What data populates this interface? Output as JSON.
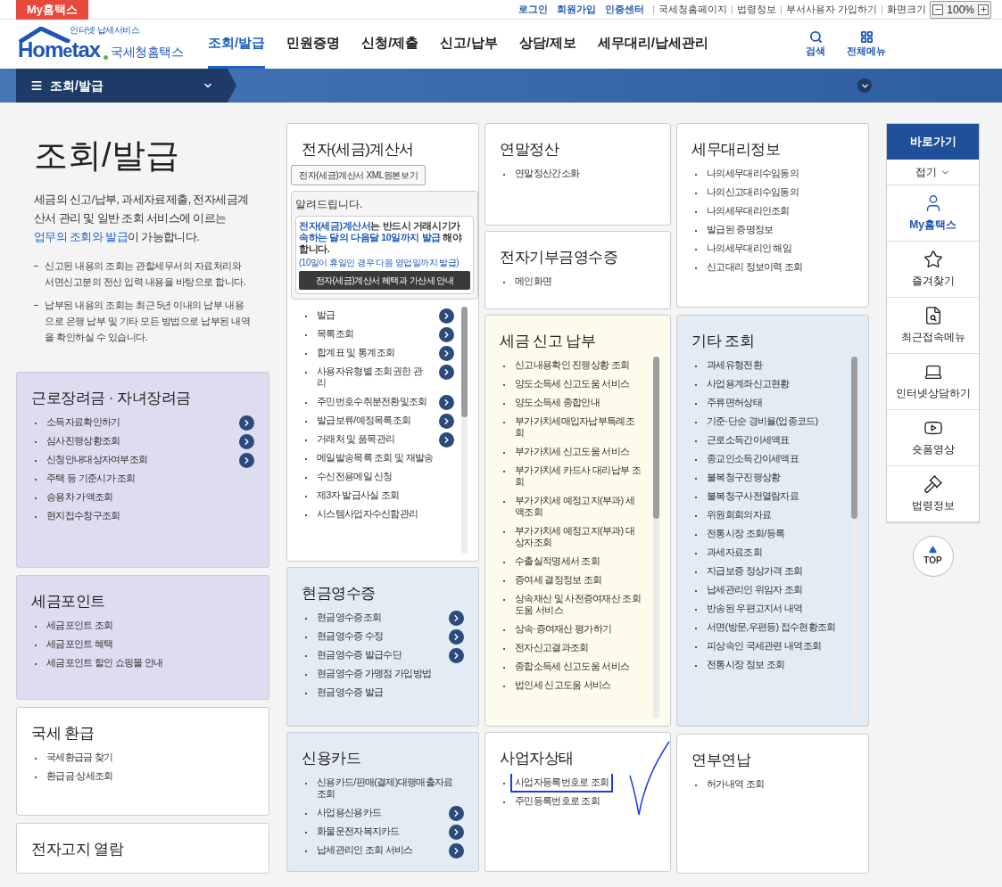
{
  "top_bar": {
    "my_tab": "My홈택스",
    "links": [
      {
        "label": "로그인",
        "emphasized": true
      },
      {
        "label": "회원가입",
        "emphasized": true
      },
      {
        "label": "인증센터",
        "emphasized": true
      },
      {
        "label": "국세청홈페이지",
        "emphasized": false
      },
      {
        "label": "법령정보",
        "emphasized": false
      },
      {
        "label": "부서사용자 가입하기",
        "emphasized": false
      }
    ],
    "zoom": {
      "label": "화면크기",
      "value": "100%"
    }
  },
  "header": {
    "logo": {
      "tagline": "인터넷 납세서비스",
      "wordmark_left": "Hom",
      "wordmark_mid": "e",
      "wordmark_right": "tax",
      "name": "국세청홈택스"
    },
    "menu": [
      {
        "label": "조회/발급",
        "selected": true
      },
      {
        "label": "민원증명",
        "selected": false
      },
      {
        "label": "신청/제출",
        "selected": false
      },
      {
        "label": "신고/납부",
        "selected": false
      },
      {
        "label": "상담/제보",
        "selected": false
      },
      {
        "label": "세무대리/납세관리",
        "selected": false
      }
    ],
    "tools": [
      {
        "kind": "search",
        "label": "검색"
      },
      {
        "kind": "grid",
        "label": "전체메뉴"
      }
    ]
  },
  "breadcrumb": {
    "label": "조회/발급"
  },
  "intro": {
    "title": "조회/발급",
    "lead": [
      {
        "text": "세금의 신고/납부, 과세자료제출, 전자세금계산서 관리 및 일반 조회 서비스에 이르는 ",
        "link": false
      },
      {
        "text": "업무의 조회와 발급",
        "link": true
      },
      {
        "text": "이 가능합니다.",
        "link": false
      }
    ],
    "notes": [
      "신고된 내용의 조회는 관할세무서의 자료처리와 서면신고분의 전산 입력 내용을 바탕으로 합니다.",
      "납부된 내용의 조회는 최근 5년 이내의 납부 내용으로 은행 납부 및 기타 모든 방법으로 납부된 내역을 확인하실 수 있습니다."
    ]
  },
  "columns": [
    {
      "cards": [
        {
          "kind": "list",
          "title": "근로장려금 · 자녀장려금",
          "color": "#dddcf1",
          "scrollable": false,
          "items": [
            {
              "label": "소득자료확인하기",
              "arrow": true,
              "highlighted": false
            },
            {
              "label": "심사진행상황조회",
              "arrow": true,
              "highlighted": false
            },
            {
              "label": "신청안내대상자여부조회",
              "arrow": true,
              "highlighted": false
            },
            {
              "label": "주택 등 기준시가 조회",
              "arrow": false,
              "highlighted": false
            },
            {
              "label": "승용차 가액조회",
              "arrow": false,
              "highlighted": false
            },
            {
              "label": "현지접수창구조회",
              "arrow": false,
              "highlighted": false
            }
          ]
        },
        {
          "kind": "list",
          "title": "세금포인트",
          "color": "#dddcf1",
          "scrollable": false,
          "items": [
            {
              "label": "세금포인트 조회",
              "arrow": false,
              "highlighted": false
            },
            {
              "label": "세금포인트 혜택",
              "arrow": false,
              "highlighted": false
            },
            {
              "label": "세금포인트 할인 쇼핑몰 안내",
              "arrow": false,
              "highlighted": false
            }
          ]
        },
        {
          "kind": "list",
          "title": "국세 환급",
          "color": "#ffffff",
          "scrollable": false,
          "items": [
            {
              "label": "국세환급금 찾기",
              "arrow": false,
              "highlighted": false
            },
            {
              "label": "환급금 상세조회",
              "arrow": false,
              "highlighted": false
            }
          ]
        },
        {
          "kind": "list",
          "title": "전자고지 열람",
          "color": "#ffffff",
          "scrollable": false
        }
      ]
    },
    {
      "cards": [
        {
          "kind": "invoice",
          "title": "전자(세금)계산서",
          "color": "#ffffff",
          "scrollable": true,
          "button": "전자(세금)계산서 XML원본보기",
          "notice": {
            "title": "알려드립니다.",
            "message": [
              {
                "text": "전자(세금)계산서",
                "highlight": true
              },
              {
                "text": "는 반드시 거래시기가 ",
                "highlight": false
              },
              {
                "text": "속하는 달의 다음달 10일까지 발급",
                "highlight": true
              },
              {
                "text": " 해야 합니다.",
                "highlight": false
              }
            ],
            "footnote": "(10일이 휴일인 경우 다음 영업일까지 발급)",
            "banner": "전자(세금)계산서 혜택과 가산세 안내"
          },
          "items": [
            {
              "label": "발급",
              "arrow": true,
              "highlighted": false
            },
            {
              "label": "목록조회",
              "arrow": true,
              "highlighted": false
            },
            {
              "label": "합계표 및 통계조회",
              "arrow": true,
              "highlighted": false
            },
            {
              "label": "사용자유형별 조회권한 관리",
              "arrow": true,
              "highlighted": false
            },
            {
              "label": "주민번호수취분전환및조회",
              "arrow": true,
              "highlighted": false
            },
            {
              "label": "발급보류/예정목록조회",
              "arrow": true,
              "highlighted": false
            },
            {
              "label": "거래처 및 품목관리",
              "arrow": true,
              "highlighted": false
            },
            {
              "label": "메일발송목록 조회 및 재발송",
              "arrow": false,
              "highlighted": false
            },
            {
              "label": "수신전용메일 신청",
              "arrow": false,
              "highlighted": false
            },
            {
              "label": "제3자 발급사실 조회",
              "arrow": false,
              "highlighted": false
            },
            {
              "label": "시스템사업자수신함관리",
              "arrow": false,
              "highlighted": false
            }
          ]
        },
        {
          "kind": "list",
          "title": "현금영수증",
          "color": "#e3ebf4",
          "scrollable": false,
          "items": [
            {
              "label": "현금영수증조회",
              "arrow": true,
              "highlighted": false
            },
            {
              "label": "현금영수증 수정",
              "arrow": true,
              "highlighted": false
            },
            {
              "label": "현금영수증 발급수단",
              "arrow": true,
              "highlighted": false
            },
            {
              "label": "현금영수증 가맹점 가입방법",
              "arrow": false,
              "highlighted": false
            },
            {
              "label": "현금영수증 발급",
              "arrow": false,
              "highlighted": false
            }
          ]
        },
        {
          "kind": "list",
          "title": "신용카드",
          "color": "#e3ebf4",
          "scrollable": false,
          "items": [
            {
              "label": "신용카드/판매(결제)대행매출자료조회",
              "arrow": false,
              "highlighted": false
            },
            {
              "label": "사업용신용카드",
              "arrow": true,
              "highlighted": false
            },
            {
              "label": "화물운전자복지카드",
              "arrow": true,
              "highlighted": false
            },
            {
              "label": "납세관리인 조회 서비스",
              "arrow": true,
              "highlighted": false
            }
          ]
        }
      ]
    },
    {
      "cards": [
        {
          "kind": "list",
          "title": "연말정산",
          "color": "#ffffff",
          "scrollable": false,
          "items": [
            {
              "label": "연말정산간소화",
              "arrow": false,
              "highlighted": false
            }
          ]
        },
        {
          "kind": "list",
          "title": "전자기부금영수증",
          "color": "#ffffff",
          "scrollable": false,
          "items": [
            {
              "label": "메인화면",
              "arrow": false,
              "highlighted": false
            }
          ]
        },
        {
          "kind": "list",
          "title": "세금 신고 납부",
          "color": "#fdfbeb",
          "scrollable": true,
          "items": [
            {
              "label": "신고내용확인 진행상황 조회",
              "arrow": false,
              "highlighted": false
            },
            {
              "label": "양도소득세 신고도움 서비스",
              "arrow": false,
              "highlighted": false
            },
            {
              "label": "양도소득세 종합안내",
              "arrow": false,
              "highlighted": false
            },
            {
              "label": "부가가치세매입자납부특례조회",
              "arrow": false,
              "highlighted": false
            },
            {
              "label": "부가가치세 신고도움 서비스",
              "arrow": false,
              "highlighted": false
            },
            {
              "label": "부가가치세 카드사 대리납부 조회",
              "arrow": false,
              "highlighted": false
            },
            {
              "label": "부가가치세 예정고지(부과) 세액조회",
              "arrow": false,
              "highlighted": false
            },
            {
              "label": "부가가치세 예정고지(부과) 대상자조회",
              "arrow": false,
              "highlighted": false
            },
            {
              "label": "수출실적명세서 조회",
              "arrow": false,
              "highlighted": false
            },
            {
              "label": "증여세 결정정보 조회",
              "arrow": false,
              "highlighted": false
            },
            {
              "label": "상속재산 및 사전증여재산 조회 도움 서비스",
              "arrow": false,
              "highlighted": false
            },
            {
              "label": "상속·증여재산 평가하기",
              "arrow": false,
              "highlighted": false
            },
            {
              "label": "전자신고결과조회",
              "arrow": false,
              "highlighted": false
            },
            {
              "label": "종합소득세 신고도움 서비스",
              "arrow": false,
              "highlighted": false
            },
            {
              "label": "법인세 신고도움 서비스",
              "arrow": false,
              "highlighted": false
            }
          ]
        },
        {
          "kind": "list",
          "title": "사업자상태",
          "color": "#ffffff",
          "scrollable": false,
          "items": [
            {
              "label": "사업자등록번호로 조회",
              "arrow": false,
              "highlighted": true
            },
            {
              "label": "주민등록번호로 조회",
              "arrow": false,
              "highlighted": false
            }
          ]
        }
      ]
    },
    {
      "cards": [
        {
          "kind": "list",
          "title": "세무대리정보",
          "color": "#ffffff",
          "scrollable": false,
          "items": [
            {
              "label": "나의세무대리수임동의",
              "arrow": false,
              "highlighted": false
            },
            {
              "label": "나의신고대리수임동의",
              "arrow": false,
              "highlighted": false
            },
            {
              "label": "나의세무대리인조회",
              "arrow": false,
              "highlighted": false
            },
            {
              "label": "발급된 증명정보",
              "arrow": false,
              "highlighted": false
            },
            {
              "label": "나의세무대리인 해임",
              "arrow": false,
              "highlighted": false
            },
            {
              "label": "신고대리 정보이력 조회",
              "arrow": false,
              "highlighted": false
            }
          ]
        },
        {
          "kind": "list",
          "title": "기타 조회",
          "color": "#e3ebf4",
          "scrollable": true,
          "items": [
            {
              "label": "과세유형전환",
              "arrow": false,
              "highlighted": false
            },
            {
              "label": "사업용계좌신고현황",
              "arrow": false,
              "highlighted": false
            },
            {
              "label": "주류면허상태",
              "arrow": false,
              "highlighted": false
            },
            {
              "label": "기준·단순 경비율(업종코드)",
              "arrow": false,
              "highlighted": false
            },
            {
              "label": "근로소득간이세액표",
              "arrow": false,
              "highlighted": false
            },
            {
              "label": "종교인소득간이세액표",
              "arrow": false,
              "highlighted": false
            },
            {
              "label": "불복청구진행상황",
              "arrow": false,
              "highlighted": false
            },
            {
              "label": "불복청구사전열람자료",
              "arrow": false,
              "highlighted": false
            },
            {
              "label": "위원회회의자료",
              "arrow": false,
              "highlighted": false
            },
            {
              "label": "전통시장 조회/등록",
              "arrow": false,
              "highlighted": false
            },
            {
              "label": "과세자료조회",
              "arrow": false,
              "highlighted": false
            },
            {
              "label": "지급보증 정상가격 조회",
              "arrow": false,
              "highlighted": false
            },
            {
              "label": "납세관리인 위임자 조회",
              "arrow": false,
              "highlighted": false
            },
            {
              "label": "반송된 우편고지서 내역",
              "arrow": false,
              "highlighted": false
            },
            {
              "label": "서면(방문,우편등) 접수현황조회",
              "arrow": false,
              "highlighted": false
            },
            {
              "label": "피상속인 국세관련 내역조회",
              "arrow": false,
              "highlighted": false
            },
            {
              "label": "전통시장 정보 조회",
              "arrow": false,
              "highlighted": false
            }
          ]
        },
        {
          "kind": "list",
          "title": "연부연납",
          "color": "#ffffff",
          "scrollable": false,
          "items": [
            {
              "label": "허가내역 조회",
              "arrow": false,
              "highlighted": false
            }
          ]
        }
      ]
    }
  ],
  "quick_menu": {
    "title": "바로가기",
    "collapse": "접기",
    "items": [
      {
        "kind": "user",
        "label": "My홈택스",
        "selected": true
      },
      {
        "kind": "star",
        "label": "즐겨찾기",
        "selected": false
      },
      {
        "kind": "recent",
        "label": "최근접속메뉴",
        "selected": false
      },
      {
        "kind": "chat",
        "label": "인터넷상담하기",
        "selected": false
      },
      {
        "kind": "video",
        "label": "숏폼영상",
        "selected": false
      },
      {
        "kind": "law",
        "label": "법령정보",
        "selected": false
      }
    ],
    "top": "TOP"
  }
}
